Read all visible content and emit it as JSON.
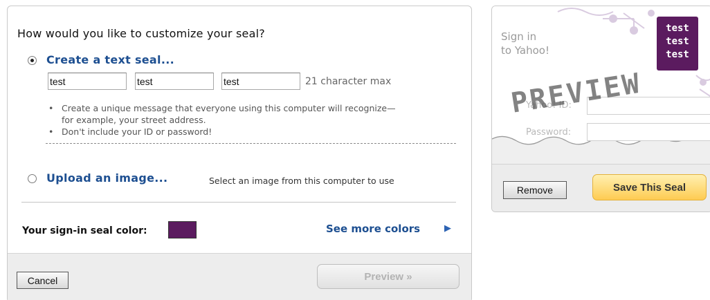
{
  "customize": {
    "question": "How would you like to customize your seal?",
    "option_text_seal": "Create a text seal...",
    "text_seal_lines": [
      "test",
      "test",
      "test"
    ],
    "char_max_note": "21 character max",
    "bullets": [
      "Create a unique message that everyone using this computer will recognize—",
      "for example, your street address.",
      "Don't include your ID or password!"
    ],
    "option_upload": "Upload an image...",
    "upload_hint": "Select an image from this computer to use",
    "seal_color_label": "Your sign-in seal color:",
    "seal_color": "#5b1b5f",
    "see_more_colors": "See more colors",
    "selected_option": "text"
  },
  "footer": {
    "cancel_label": "Cancel",
    "preview_label": "Preview »"
  },
  "preview": {
    "signin_line1": "Sign in",
    "signin_line2": "to Yahoo!",
    "seal_badge_lines": [
      "test",
      "test",
      "test"
    ],
    "yahoo_id_label": "Yahoo! ID:",
    "password_label": "Password:",
    "watermark": "PREVIEW",
    "remove_label": "Remove",
    "save_label": "Save This Seal"
  }
}
